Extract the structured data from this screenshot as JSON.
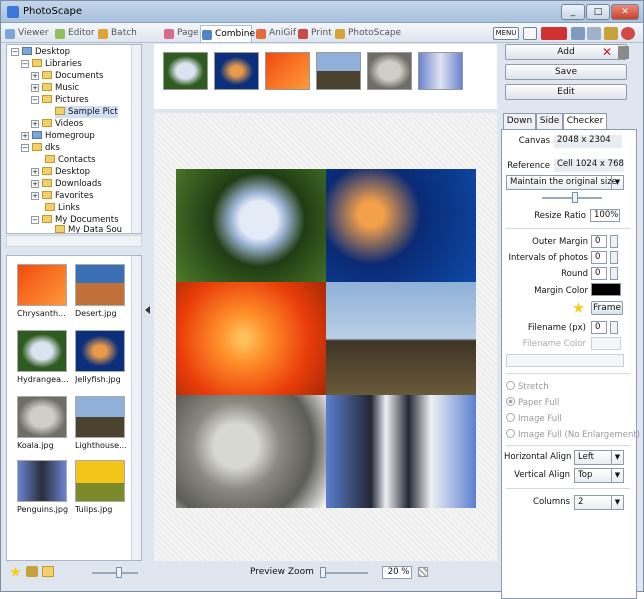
{
  "window": {
    "title": "PhotoScape",
    "min": "_",
    "max": "□",
    "close": "✕"
  },
  "tabs": [
    {
      "label": "Viewer",
      "color": "#7aa7d8"
    },
    {
      "label": "Editor",
      "color": "#8fbf5a"
    },
    {
      "label": "Batch Editor",
      "color": "#e0a33a"
    },
    {
      "label": "Page",
      "color": "#d86a8c"
    },
    {
      "label": "Combine",
      "color": "#4f86c6"
    },
    {
      "label": "AniGif",
      "color": "#e46b3b"
    },
    {
      "label": "Print",
      "color": "#c84b4b"
    },
    {
      "label": "PhotoScape",
      "color": "#d8a23a"
    }
  ],
  "toolbar": {
    "menu": "MENU"
  },
  "tree": {
    "items": [
      {
        "label": "Desktop",
        "level": 0
      },
      {
        "label": "Libraries",
        "level": 1
      },
      {
        "label": "Documents",
        "level": 2
      },
      {
        "label": "Music",
        "level": 2
      },
      {
        "label": "Pictures",
        "level": 2
      },
      {
        "label": "Sample Pict",
        "level": 3
      },
      {
        "label": "Videos",
        "level": 2
      },
      {
        "label": "Homegroup",
        "level": 1
      },
      {
        "label": "dks",
        "level": 1
      },
      {
        "label": "Contacts",
        "level": 2
      },
      {
        "label": "Desktop",
        "level": 2
      },
      {
        "label": "Downloads",
        "level": 2
      },
      {
        "label": "Favorites",
        "level": 2
      },
      {
        "label": "Links",
        "level": 2
      },
      {
        "label": "My Documents",
        "level": 2
      },
      {
        "label": "My Data Sou",
        "level": 3
      }
    ]
  },
  "thumbs": [
    {
      "label": "Chrysanth...",
      "c1": "#f04a10",
      "c2": "#ff9a3a"
    },
    {
      "label": "Desert.jpg",
      "c1": "#3a6fb5",
      "c2": "#c2703a"
    },
    {
      "label": "Hydrangea...",
      "c1": "#2e5b1f",
      "c2": "#dbe3f0"
    },
    {
      "label": "Jellyfish.jpg",
      "c1": "#0b2f7a",
      "c2": "#e89a4a"
    },
    {
      "label": "Koala.jpg",
      "c1": "#6e6e66",
      "c2": "#cfcfc8"
    },
    {
      "label": "Lighthouse...",
      "c1": "#8fb0d8",
      "c2": "#4b4330"
    },
    {
      "label": "Penguins.jpg",
      "c1": "#6a83d0",
      "c2": "#2a2e3a"
    },
    {
      "label": "Tulips.jpg",
      "c1": "#f3c41a",
      "c2": "#7a8a2a"
    }
  ],
  "strip": [
    {
      "c1": "#2e5b1f",
      "c2": "#dbe3f0"
    },
    {
      "c1": "#0b2f7a",
      "c2": "#e89a4a"
    },
    {
      "c1": "#f04a10",
      "c2": "#ff9a3a"
    },
    {
      "c1": "#8fb0d8",
      "c2": "#4b4330"
    },
    {
      "c1": "#6e6e66",
      "c2": "#cfcfc8"
    },
    {
      "c1": "#6a83d0",
      "c2": "#dfe4f0"
    }
  ],
  "collage": [
    {
      "name": "hydrangea",
      "c1": "#1f3d14",
      "c2": "#e4ebf7"
    },
    {
      "name": "jellyfish",
      "c1": "#0a2a74",
      "c2": "#f3a04a"
    },
    {
      "name": "chrysanthemum",
      "c1": "#e93c0a",
      "c2": "#ff8f2a"
    },
    {
      "name": "lighthouse",
      "c1": "#8fb0d8",
      "c2": "#3e3526"
    },
    {
      "name": "koala",
      "c1": "#5d5d57",
      "c2": "#d8d8d2"
    },
    {
      "name": "penguins",
      "c1": "#5b7fd0",
      "c2": "#232733"
    }
  ],
  "zoom": {
    "label": "Preview Zoom",
    "value": "20 %"
  },
  "right": {
    "add": "Add",
    "save": "Save",
    "edit": "Edit",
    "tabs": [
      "Down",
      "Side",
      "Checker"
    ],
    "canvas_label": "Canvas",
    "canvas_value": "2048 x 2304",
    "reference_label": "Reference",
    "reference_value": "Cell 1024 x 768",
    "size_mode": "Maintain the original size",
    "resize_label": "Resize Ratio",
    "resize_value": "100%",
    "outer_margin_label": "Outer Margin",
    "outer_margin_value": "0",
    "intervals_label": "Intervals of photos",
    "intervals_value": "0",
    "round_label": "Round",
    "round_value": "0",
    "margin_color_label": "Margin Color",
    "frame_label": "Frame",
    "filename_label": "Filename (px)",
    "filename_value": "0",
    "filename_color_label": "Filename Color",
    "radios": [
      "Stretch",
      "Paper Full",
      "Image Full",
      "Image Full (No Enlargement)"
    ],
    "halign_label": "Horizontal Align",
    "halign_value": "Left",
    "valign_label": "Vertical Align",
    "valign_value": "Top",
    "columns_label": "Columns",
    "columns_value": "2"
  }
}
